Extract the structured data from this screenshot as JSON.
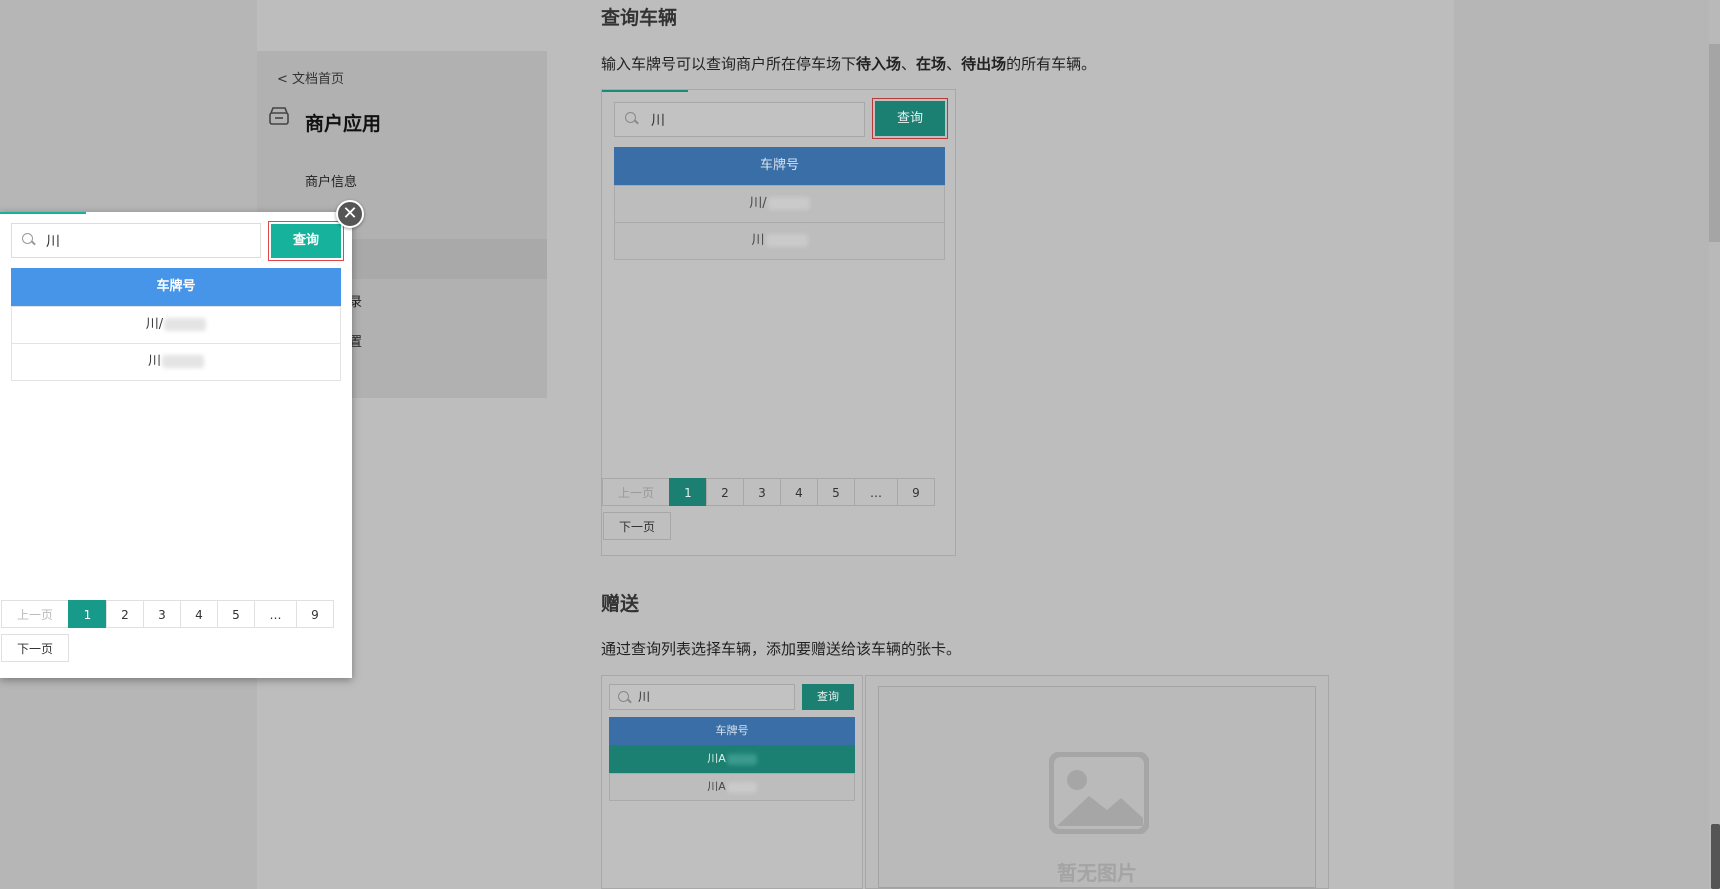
{
  "sidebar": {
    "back_link": "< 文档首页",
    "title": "商户应用",
    "items": [
      "商户信息",
      "录",
      "置"
    ]
  },
  "main": {
    "section1": {
      "title": "查询车辆",
      "desc_prefix": "输入车牌号可以查询商户所在停车场下",
      "desc_b1": "待入场",
      "desc_sep1": "、",
      "desc_b2": "在场",
      "desc_sep2": "、",
      "desc_b3": "待出场",
      "desc_suffix": "的所有车辆。"
    },
    "section2": {
      "title": "赠送",
      "desc": "通过查询列表选择车辆，添加要赠送给该车辆的张卡。"
    },
    "no_image_text": "暂无图片"
  },
  "query_panel": {
    "search_value": "川",
    "query_button": "查询",
    "column_header": "车牌号",
    "rows": [
      "川/",
      "川"
    ],
    "pager": {
      "prev": "上一页",
      "pages": [
        "1",
        "2",
        "3",
        "4",
        "5",
        "…",
        "9"
      ],
      "active_page": "1",
      "next": "下一页"
    }
  },
  "small_panel": {
    "search_value": "川",
    "query_button": "查询",
    "column_header": "车牌号",
    "rows": [
      "川A",
      "川A"
    ]
  },
  "colors": {
    "primary_teal": "#17b29c",
    "header_blue": "#4795e8",
    "highlight_border": "#e04848"
  }
}
